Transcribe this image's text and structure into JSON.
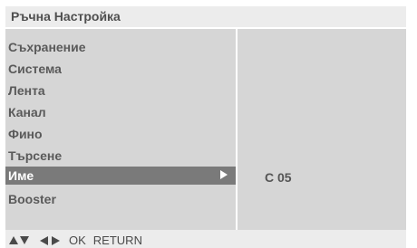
{
  "window": {
    "title": "Ръчна Настройка"
  },
  "menu": {
    "items": [
      {
        "label": "Съхранение"
      },
      {
        "label": "Система"
      },
      {
        "label": "Лента"
      },
      {
        "label": "Канал"
      },
      {
        "label": "Фино"
      },
      {
        "label": "Търсене"
      },
      {
        "label": "Име",
        "selected": true
      },
      {
        "label": "Booster"
      }
    ]
  },
  "detail": {
    "value": "C 05"
  },
  "footer": {
    "ok_label": "OK",
    "return_label": "RETURN",
    "icons": [
      "up-arrow-icon",
      "down-arrow-icon",
      "left-arrow-icon",
      "right-arrow-icon"
    ]
  },
  "colors": {
    "panel_bg": "#d6d6d6",
    "header_bg": "#ececec",
    "selected_bg": "#7a7a7a",
    "selected_text": "#ffffff",
    "text": "#5a5a5a"
  }
}
